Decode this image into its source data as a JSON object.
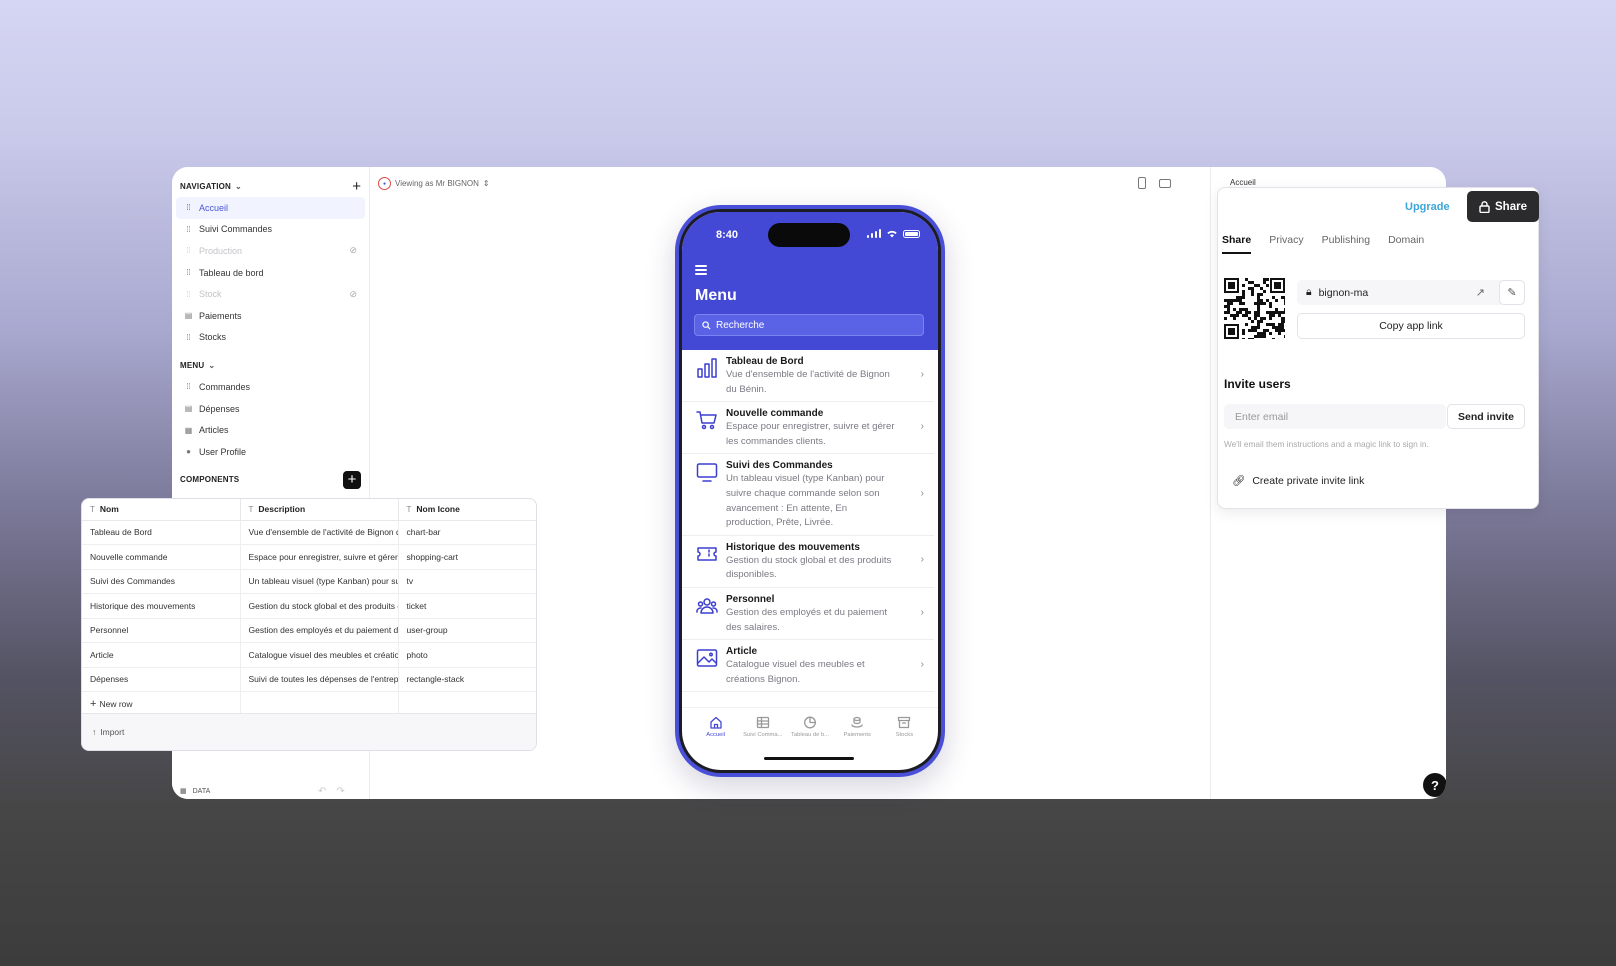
{
  "sidebar": {
    "navigation_title": "NAVIGATION",
    "nav_items": [
      {
        "label": "Accueil",
        "icon": "dots-icon",
        "state": "active"
      },
      {
        "label": "Suivi Commandes",
        "icon": "dots-icon",
        "state": "normal"
      },
      {
        "label": "Production",
        "icon": "dots-icon",
        "state": "hidden"
      },
      {
        "label": "Tableau de bord",
        "icon": "dots-icon",
        "state": "normal"
      },
      {
        "label": "Stock",
        "icon": "dots-icon",
        "state": "hidden"
      },
      {
        "label": "Paiements",
        "icon": "table-icon",
        "state": "normal"
      },
      {
        "label": "Stocks",
        "icon": "dots-icon",
        "state": "normal"
      }
    ],
    "menu_title": "MENU",
    "menu_items": [
      {
        "label": "Commandes",
        "icon": "dots-icon"
      },
      {
        "label": "Dépenses",
        "icon": "table-icon"
      },
      {
        "label": "Articles",
        "icon": "grid-icon"
      },
      {
        "label": "User Profile",
        "icon": "user-icon"
      }
    ],
    "components_title": "COMPONENTS",
    "data_label": "DATA"
  },
  "viewing_as": "Viewing as Mr BIGNON",
  "phone": {
    "time": "8:40",
    "title": "Menu",
    "search_placeholder": "Recherche",
    "items": [
      {
        "title": "Tableau de Bord",
        "desc": "Vue d'ensemble de l'activité de Bignon du Bénin.",
        "icon": "chart-bar"
      },
      {
        "title": "Nouvelle commande",
        "desc": "Espace pour enregistrer, suivre et gérer les commandes clients.",
        "icon": "shopping-cart"
      },
      {
        "title": "Suivi des Commandes",
        "desc": "Un tableau visuel (type Kanban) pour suivre chaque commande selon son avancement : En attente, En production, Prête, Livrée.",
        "icon": "tv"
      },
      {
        "title": "Historique des mouvements",
        "desc": "Gestion du stock global et des produits disponibles.",
        "icon": "ticket"
      },
      {
        "title": "Personnel",
        "desc": "Gestion des employés et du paiement des salaires.",
        "icon": "user-group"
      },
      {
        "title": "Article",
        "desc": "Catalogue visuel des meubles et créations Bignon.",
        "icon": "photo"
      }
    ],
    "tabs": [
      {
        "label": "Accueil",
        "icon": "home-icon",
        "active": true
      },
      {
        "label": "Suivi Comma...",
        "icon": "table-icon",
        "active": false
      },
      {
        "label": "Tableau de b...",
        "icon": "pie-icon",
        "active": false
      },
      {
        "label": "Paiements",
        "icon": "coins-icon",
        "active": false
      },
      {
        "label": "Stocks",
        "icon": "archive-icon",
        "active": false
      }
    ]
  },
  "table": {
    "columns": [
      "Nom",
      "Description",
      "Nom Icone"
    ],
    "rows": [
      [
        "Tableau de Bord",
        "Vue d'ensemble de l'activité de Bignon du Bénin.",
        "chart-bar"
      ],
      [
        "Nouvelle commande",
        "Espace pour enregistrer, suivre et gérer les commandes clients.",
        "shopping-cart"
      ],
      [
        "Suivi des Commandes",
        "Un tableau visuel (type Kanban) pour suivre chaque commande",
        "tv"
      ],
      [
        "Historique des mouvements",
        "Gestion du stock global et des produits disponibles.",
        "ticket"
      ],
      [
        "Personnel",
        "Gestion des employés et du paiement des salaires.",
        "user-group"
      ],
      [
        "Article",
        "Catalogue visuel des meubles et créations Bignon.",
        "photo"
      ],
      [
        "Dépenses",
        "Suivi de toutes les dépenses de l'entreprise.",
        "rectangle-stack"
      ]
    ],
    "new_row": "New row",
    "import": "Import"
  },
  "share_panel": {
    "page_tag": "Accueil",
    "upgrade": "Upgrade",
    "share": "Share",
    "tabs": [
      "Share",
      "Privacy",
      "Publishing",
      "Domain"
    ],
    "app_slug": "bignon-ma",
    "copy_link": "Copy app link",
    "invite_title": "Invite users",
    "email_placeholder": "Enter email",
    "send_invite": "Send invite",
    "hint": "We'll email them instructions and a magic link to sign in.",
    "private_link": "Create private invite link"
  },
  "colors": {
    "accent": "#4348d5",
    "upgrade": "#3ea5d8",
    "dark": "#2b2b2e"
  }
}
